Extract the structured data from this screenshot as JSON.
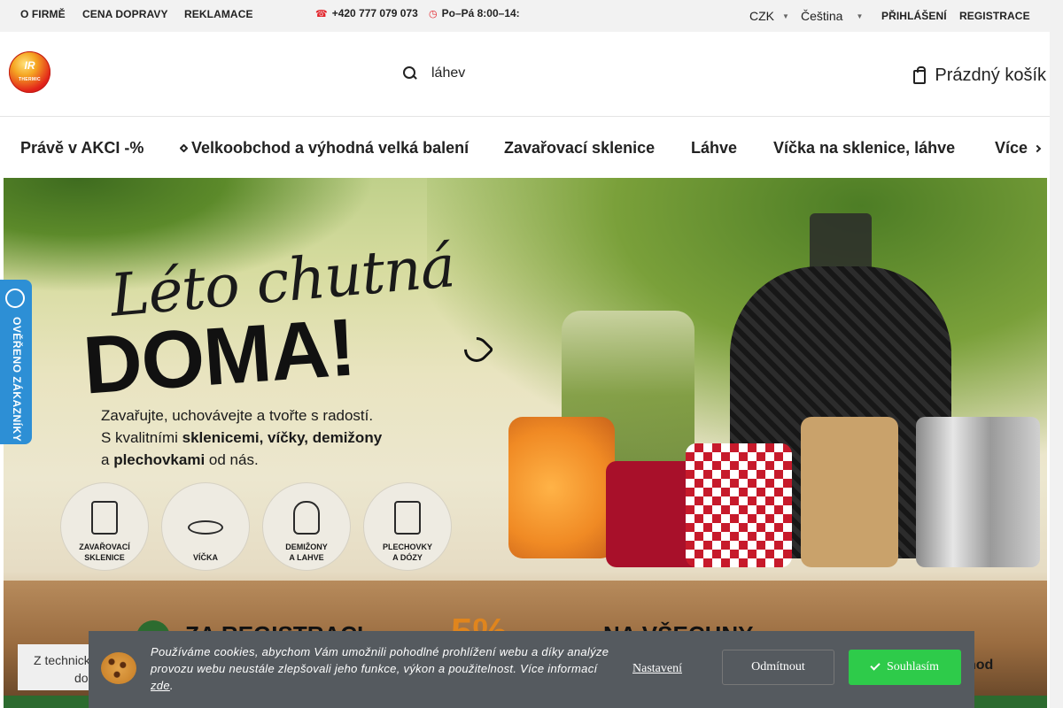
{
  "topbar": {
    "links": [
      "O FIRMĚ",
      "CENA DOPRAVY",
      "REKLAMACE"
    ],
    "phone": "+420 777 079 073",
    "hours": "Po–Pá 8:00–14:",
    "currency": "CZK",
    "language": "Čeština",
    "login": "PŘIHLÁŠENÍ",
    "register": "REGISTRACE"
  },
  "header": {
    "logo_text": "IR",
    "logo_subtext": "THERMIC",
    "search_value": "láhev",
    "cart_label": "Prázdný košík"
  },
  "nav": {
    "items": [
      "Právě v AKCI -%",
      "Velkoobchod a výhodná velká balení",
      "Zavařovací sklenice",
      "Láhve",
      "Víčka na sklenice, láhve",
      "Více"
    ]
  },
  "banner": {
    "headline_top": "Léto chutná",
    "headline_main": "DOMA!",
    "sub_line1": "Zavařujte, uchovávejte a tvořte s radostí.",
    "sub_line2_prefix": "S kvalitními ",
    "sub_line2_bold": "sklenicemi, víčky, demižony",
    "sub_line3_prefix": "a ",
    "sub_line3_bold": "plechovkami",
    "sub_line3_suffix": " od nás.",
    "categories": [
      {
        "label1": "ZAVAŘOVACÍ",
        "label2": "SKLENICE"
      },
      {
        "label1": "VÍČKA",
        "label2": ""
      },
      {
        "label1": "DEMIŽONY",
        "label2": "A LAHVE"
      },
      {
        "label1": "PLECHOVKY",
        "label2": "A DÓZY"
      }
    ],
    "promo_left": "ZA REGISTRACI",
    "promo_mid": "5%",
    "promo_right": "NA VŠECHNY"
  },
  "verified_badge": "OVĚŘENO ZÁKAZNÍKY",
  "notice": {
    "line1": "Z technických",
    "line2": "do"
  },
  "right_fragment": "hod",
  "cookie": {
    "message_before": "Používáme cookies, abychom Vám umožnili pohodlné prohlížení webu a díky analýze provozu webu neustále zlepšovali jeho funkce, výkon a použitelnost. Více informací ",
    "message_link": "zde",
    "message_after": ".",
    "settings": "Nastavení",
    "reject": "Odmítnout",
    "accept": "Souhlasím"
  },
  "colors": {
    "accent_red": "#e3242b",
    "cookie_bg": "#555a5f",
    "accept_green": "#2ecb4a",
    "badge_blue": "#2d8fd5"
  }
}
